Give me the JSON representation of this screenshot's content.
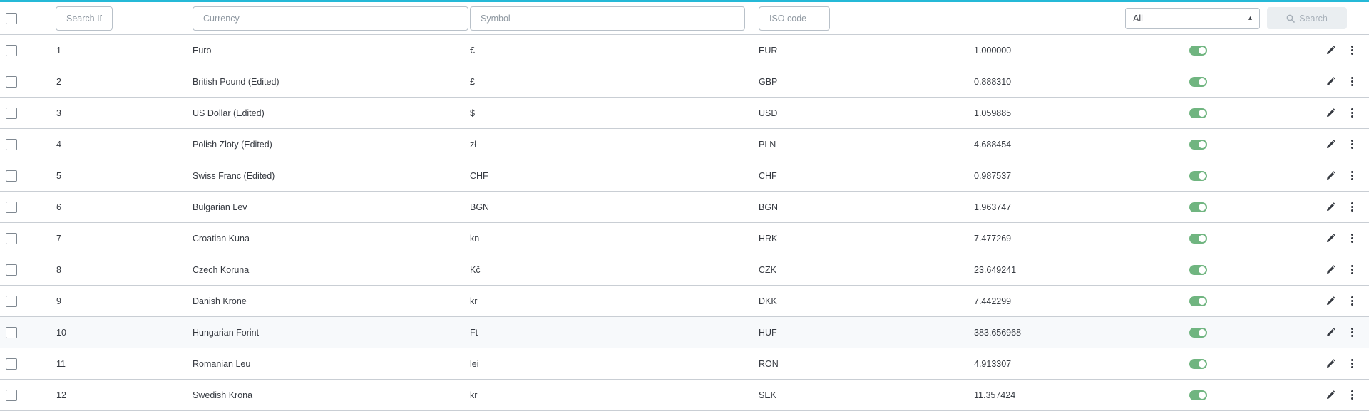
{
  "colors": {
    "accent": "#25b9d7",
    "toggle_on": "#70b580"
  },
  "filters": {
    "id_placeholder": "Search ID",
    "currency_placeholder": "Currency",
    "symbol_placeholder": "Symbol",
    "iso_placeholder": "ISO code",
    "status_selected": "All",
    "search_label": "Search"
  },
  "rows": [
    {
      "id": "1",
      "currency": "Euro",
      "symbol": "€",
      "iso": "EUR",
      "rate": "1.000000",
      "enabled": true
    },
    {
      "id": "2",
      "currency": "British Pound (Edited)",
      "symbol": "£",
      "iso": "GBP",
      "rate": "0.888310",
      "enabled": true
    },
    {
      "id": "3",
      "currency": "US Dollar (Edited)",
      "symbol": "$",
      "iso": "USD",
      "rate": "1.059885",
      "enabled": true
    },
    {
      "id": "4",
      "currency": "Polish Zloty (Edited)",
      "symbol": "zł",
      "iso": "PLN",
      "rate": "4.688454",
      "enabled": true
    },
    {
      "id": "5",
      "currency": "Swiss Franc (Edited)",
      "symbol": "CHF",
      "iso": "CHF",
      "rate": "0.987537",
      "enabled": true
    },
    {
      "id": "6",
      "currency": "Bulgarian Lev",
      "symbol": "BGN",
      "iso": "BGN",
      "rate": "1.963747",
      "enabled": true
    },
    {
      "id": "7",
      "currency": "Croatian Kuna",
      "symbol": "kn",
      "iso": "HRK",
      "rate": "7.477269",
      "enabled": true
    },
    {
      "id": "8",
      "currency": "Czech Koruna",
      "symbol": "Kč",
      "iso": "CZK",
      "rate": "23.649241",
      "enabled": true
    },
    {
      "id": "9",
      "currency": "Danish Krone",
      "symbol": "kr",
      "iso": "DKK",
      "rate": "7.442299",
      "enabled": true
    },
    {
      "id": "10",
      "currency": "Hungarian Forint",
      "symbol": "Ft",
      "iso": "HUF",
      "rate": "383.656968",
      "enabled": true
    },
    {
      "id": "11",
      "currency": "Romanian Leu",
      "symbol": "lei",
      "iso": "RON",
      "rate": "4.913307",
      "enabled": true
    },
    {
      "id": "12",
      "currency": "Swedish Krona",
      "symbol": "kr",
      "iso": "SEK",
      "rate": "11.357424",
      "enabled": true
    }
  ]
}
